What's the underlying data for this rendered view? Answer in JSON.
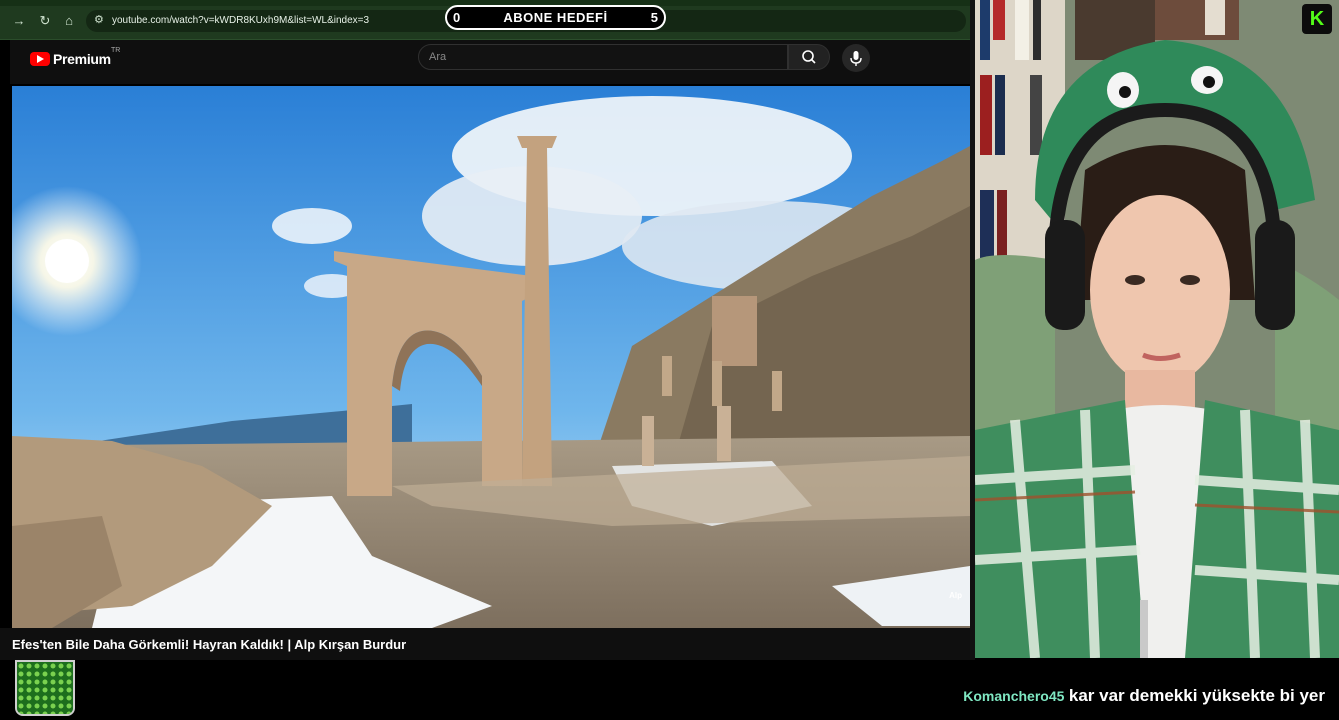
{
  "browser": {
    "back_icon": "arrow-right-icon",
    "url": "youtube.com/watch?v=kWDR8KUxh9M&list=WL&index=3"
  },
  "goal": {
    "start": "0",
    "title": "ABONE HEDEFİ",
    "end": "5"
  },
  "youtube": {
    "logo_text": "Premium",
    "region": "TR",
    "search_placeholder": "Ara"
  },
  "video": {
    "title": "Efes'ten Bile Daha Görkemli! Hayran Kaldık! | Alp Kırşan Burdur",
    "watermark": "Alp"
  },
  "overlay": {
    "badge": "K"
  },
  "chat": {
    "user": "Komanchero45",
    "message": "kar var demekki yüksekte bi yer"
  },
  "colors": {
    "browser_chrome": "#1f3a1f",
    "youtube_bg": "#0f0f0f",
    "kick_green": "#53fc18",
    "chat_user": "#7fe7c2"
  }
}
